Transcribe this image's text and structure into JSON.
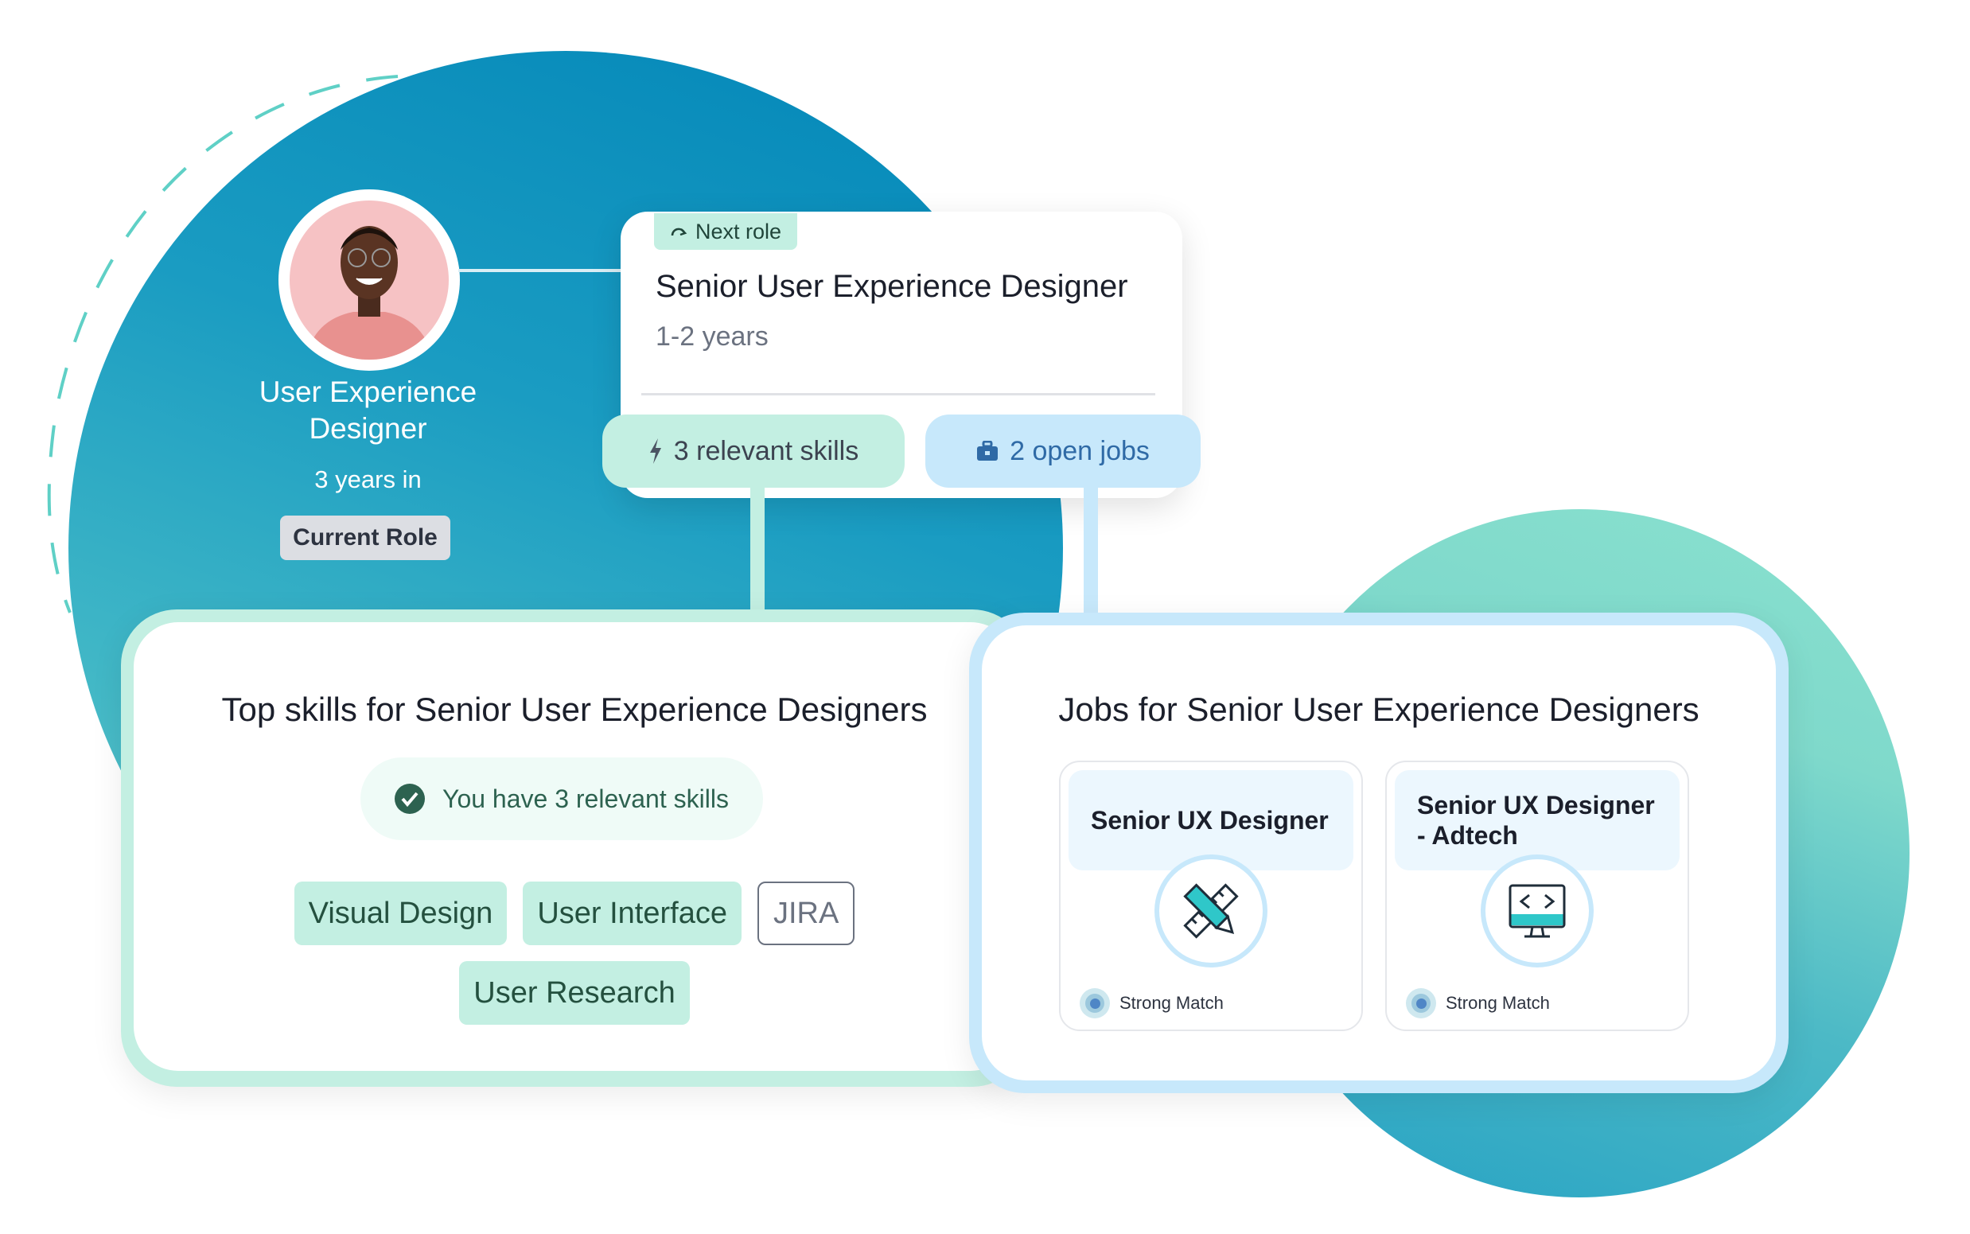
{
  "current_role": {
    "title": "User Experience Designer",
    "years": "3 years in",
    "badge": "Current Role"
  },
  "next_role": {
    "tag": "Next role",
    "title": "Senior User Experience Designer",
    "years": "1-2 years",
    "skills_pill": "3 relevant skills",
    "jobs_pill": "2 open jobs"
  },
  "skills_panel": {
    "title": "Top skills for Senior User Experience Designers",
    "have_text": "You have 3 relevant skills",
    "chips": [
      {
        "label": "Visual Design",
        "has": true
      },
      {
        "label": "User Interface",
        "has": true
      },
      {
        "label": "JIRA",
        "has": false
      },
      {
        "label": "User Research",
        "has": true
      }
    ]
  },
  "jobs_panel": {
    "title": "Jobs for Senior User Experience Designers",
    "jobs": [
      {
        "title": "Senior UX Designer",
        "icon": "pencil-ruler-icon",
        "match": "Strong Match"
      },
      {
        "title": "Senior UX Designer - Adtech",
        "icon": "code-monitor-icon",
        "match": "Strong Match"
      }
    ]
  },
  "colors": {
    "mint": "#c3efe2",
    "sky": "#c7e8fb",
    "teal_dark": "#0286b8",
    "teal_light": "#8ae1cf"
  }
}
